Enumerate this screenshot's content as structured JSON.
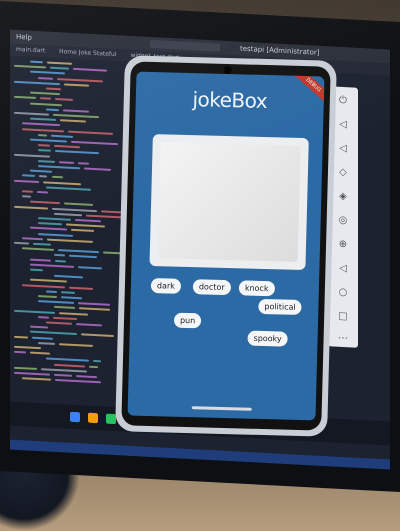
{
  "ide": {
    "window_title": "testapi [Administrator]",
    "menu_label": "Help",
    "tabs": [
      "main.dart",
      "Home Joke Stateful",
      "widget_test.dart"
    ]
  },
  "app": {
    "brand": "jokeBox",
    "debug_banner": "DEBUG",
    "categories": [
      "dark",
      "doctor",
      "knock",
      "political",
      "pun",
      "spooky"
    ]
  },
  "colors": {
    "app_background": "#2c6aa5",
    "ide_background": "#1c2230",
    "chip_background": "#f5f6f8"
  },
  "icons": {
    "emulator_controls": [
      "power-icon",
      "volume-up-icon",
      "volume-down-icon",
      "rotate-left-icon",
      "rotate-right-icon",
      "camera-icon",
      "zoom-icon",
      "back-icon",
      "home-icon",
      "overview-icon",
      "more-icon"
    ]
  }
}
